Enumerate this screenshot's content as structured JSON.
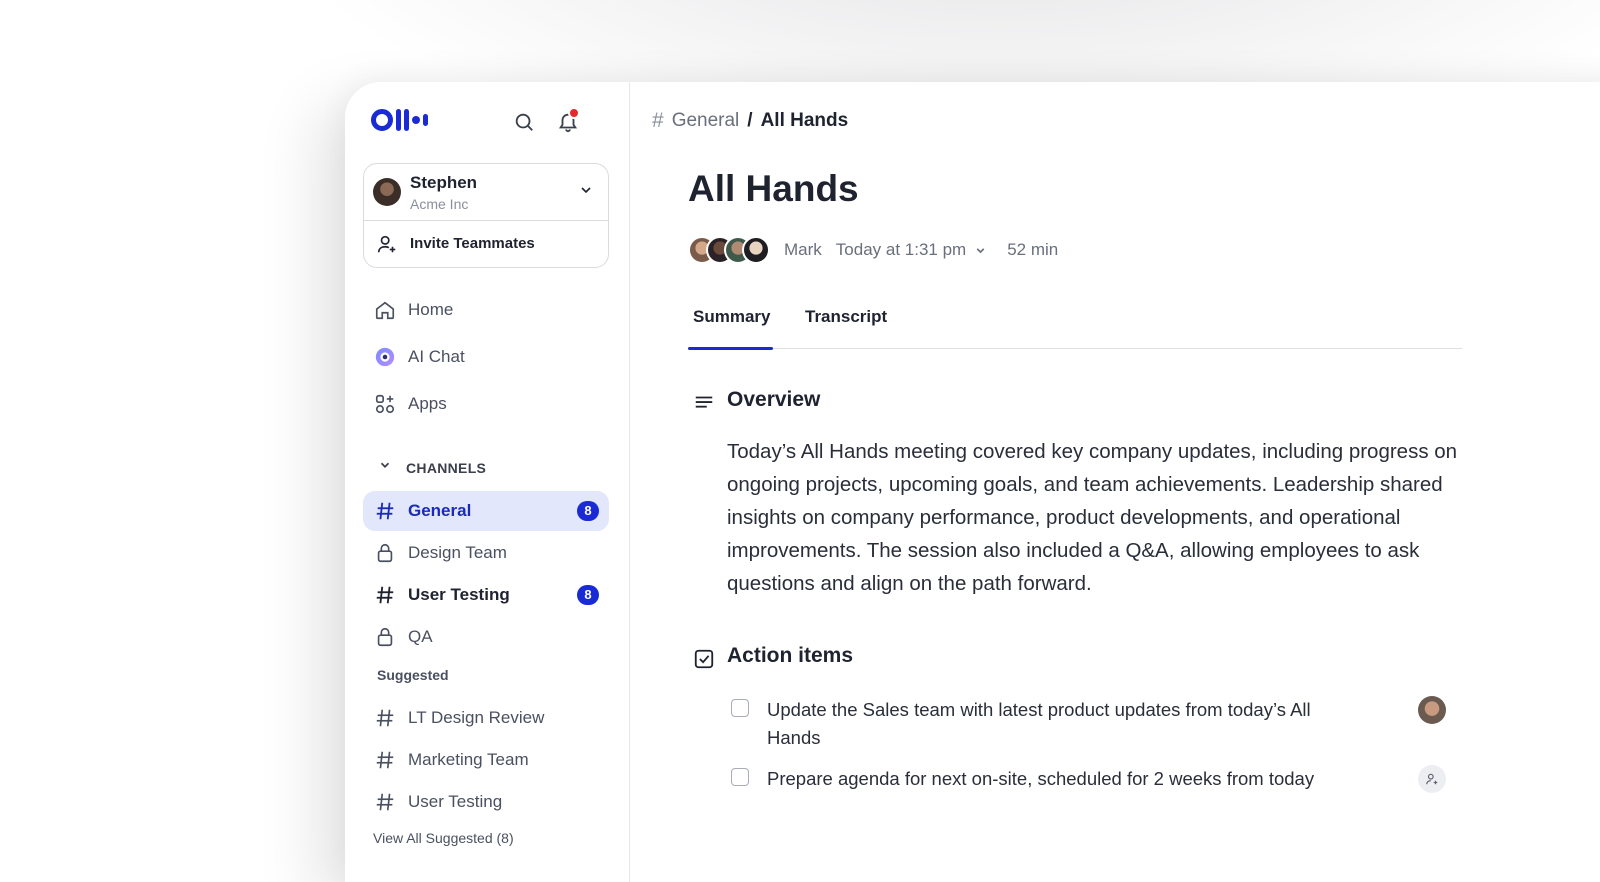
{
  "sidebar": {
    "account": {
      "name": "Stephen",
      "org": "Acme Inc"
    },
    "invite_label": "Invite Teammates",
    "nav": [
      {
        "label": "Home",
        "icon": "home-icon"
      },
      {
        "label": "AI Chat",
        "icon": "ai-chat-icon"
      },
      {
        "label": "Apps",
        "icon": "apps-icon"
      }
    ],
    "channels_header": "CHANNELS",
    "channels": [
      {
        "label": "General",
        "icon": "hash-icon",
        "badge": "8"
      },
      {
        "label": "Design Team",
        "icon": "lock-icon"
      },
      {
        "label": "User Testing",
        "icon": "hash-icon",
        "badge": "8"
      },
      {
        "label": "QA",
        "icon": "lock-icon"
      }
    ],
    "suggested_header": "Suggested",
    "suggested": [
      {
        "label": "LT Design Review",
        "icon": "hash-icon"
      },
      {
        "label": "Marketing Team",
        "icon": "hash-icon"
      },
      {
        "label": "User Testing",
        "icon": "hash-icon"
      }
    ],
    "view_all": "View All Suggested (8)"
  },
  "breadcrumb": {
    "hash": "#",
    "parent": "General",
    "separator": "/",
    "current": "All Hands"
  },
  "meeting": {
    "title": "All Hands",
    "host": "Mark",
    "datetime": "Today at 1:31 pm",
    "duration": "52 min"
  },
  "tabs": [
    {
      "label": "Summary"
    },
    {
      "label": "Transcript"
    }
  ],
  "overview": {
    "title": "Overview",
    "text": "Today’s All Hands meeting covered key company updates, including progress on ongoing projects, upcoming goals, and team achievements. Leadership shared insights on company performance, product developments, and operational improvements. The session also included a Q&A, allowing employees to ask questions and align on the path forward."
  },
  "action_items": {
    "title": "Action items",
    "items": [
      {
        "text": "Update the Sales team with latest product updates from today’s All Hands"
      },
      {
        "text": "Prepare agenda for next on-site, scheduled for 2 weeks from today"
      }
    ]
  },
  "colors": {
    "accent": "#1a2bd6",
    "active_bg": "#e3e7fc",
    "notification": "#e02b2b"
  }
}
